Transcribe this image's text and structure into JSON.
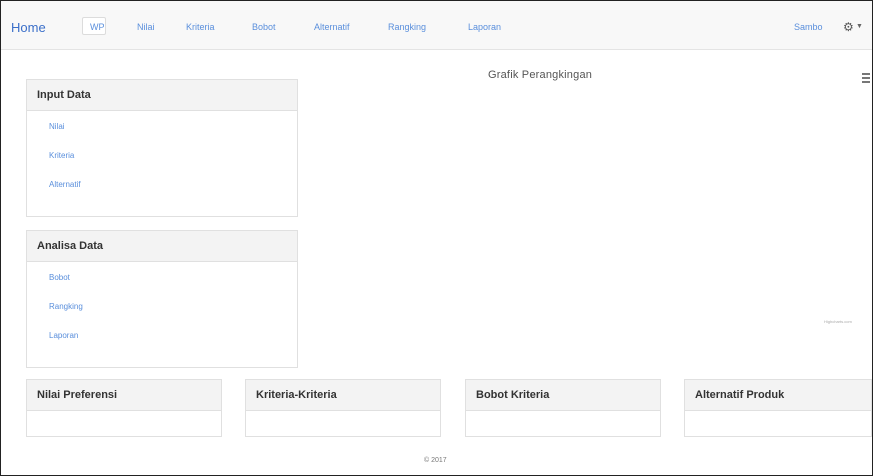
{
  "navbar": {
    "brand": "Home",
    "items": [
      "WP",
      "Nilai",
      "Kriteria",
      "Bobot",
      "Alternatif",
      "Rangking",
      "Laporan"
    ],
    "user": "Sambo",
    "gear_icon": "gear-icon"
  },
  "sidebar": {
    "input": {
      "title": "Input Data",
      "links": [
        "Nilai",
        "Kriteria",
        "Alternatif"
      ]
    },
    "analisa": {
      "title": "Analisa Data",
      "links": [
        "Bobot",
        "Rangking",
        "Laporan"
      ]
    }
  },
  "chart": {
    "title": "Grafik Perangkingan",
    "credits": "Highcharts.com"
  },
  "bottom_panels": [
    "Nilai Preferensi",
    "Kriteria-Kriteria",
    "Bobot Kriteria",
    "Alternatif Produk"
  ],
  "footer": {
    "text": "© 2017"
  }
}
